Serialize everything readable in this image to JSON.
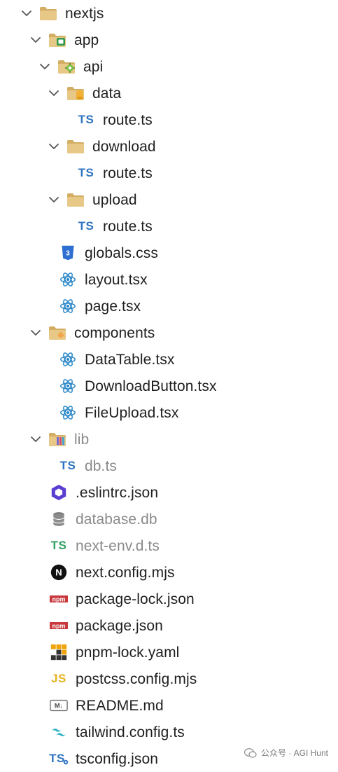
{
  "tree": [
    {
      "label": "nextjs",
      "icon": "folder-open-icon",
      "expanded": true,
      "dim": false
    },
    {
      "label": "app",
      "icon": "folder-app-icon",
      "expanded": true,
      "dim": false
    },
    {
      "label": "api",
      "icon": "folder-api-icon",
      "expanded": true,
      "dim": false
    },
    {
      "label": "data",
      "icon": "folder-data-icon",
      "expanded": true,
      "dim": false
    },
    {
      "label": "route.ts",
      "icon": "typescript-icon",
      "expanded": null,
      "dim": false
    },
    {
      "label": "download",
      "icon": "folder-open-icon",
      "expanded": true,
      "dim": false
    },
    {
      "label": "route.ts",
      "icon": "typescript-icon",
      "expanded": null,
      "dim": false
    },
    {
      "label": "upload",
      "icon": "folder-open-icon",
      "expanded": true,
      "dim": false
    },
    {
      "label": "route.ts",
      "icon": "typescript-icon",
      "expanded": null,
      "dim": false
    },
    {
      "label": "globals.css",
      "icon": "css-icon",
      "expanded": null,
      "dim": false
    },
    {
      "label": "layout.tsx",
      "icon": "react-icon",
      "expanded": null,
      "dim": false
    },
    {
      "label": "page.tsx",
      "icon": "react-icon",
      "expanded": null,
      "dim": false
    },
    {
      "label": "components",
      "icon": "folder-components-icon",
      "expanded": true,
      "dim": false
    },
    {
      "label": "DataTable.tsx",
      "icon": "react-icon",
      "expanded": null,
      "dim": false
    },
    {
      "label": "DownloadButton.tsx",
      "icon": "react-icon",
      "expanded": null,
      "dim": false
    },
    {
      "label": "FileUpload.tsx",
      "icon": "react-icon",
      "expanded": null,
      "dim": false
    },
    {
      "label": "lib",
      "icon": "folder-lib-icon",
      "expanded": true,
      "dim": true
    },
    {
      "label": "db.ts",
      "icon": "typescript-icon",
      "expanded": null,
      "dim": true
    },
    {
      "label": ".eslintrc.json",
      "icon": "eslint-icon",
      "expanded": null,
      "dim": false
    },
    {
      "label": "database.db",
      "icon": "database-icon",
      "expanded": null,
      "dim": true
    },
    {
      "label": "next-env.d.ts",
      "icon": "typescript-green-icon",
      "expanded": null,
      "dim": true
    },
    {
      "label": "next.config.mjs",
      "icon": "nextjs-icon",
      "expanded": null,
      "dim": false
    },
    {
      "label": "package-lock.json",
      "icon": "npm-icon",
      "expanded": null,
      "dim": false
    },
    {
      "label": "package.json",
      "icon": "npm-icon",
      "expanded": null,
      "dim": false
    },
    {
      "label": "pnpm-lock.yaml",
      "icon": "pnpm-icon",
      "expanded": null,
      "dim": false
    },
    {
      "label": "postcss.config.mjs",
      "icon": "javascript-icon",
      "expanded": null,
      "dim": false
    },
    {
      "label": "README.md",
      "icon": "markdown-icon",
      "expanded": null,
      "dim": false
    },
    {
      "label": "tailwind.config.ts",
      "icon": "tailwind-icon",
      "expanded": null,
      "dim": false
    },
    {
      "label": "tsconfig.json",
      "icon": "tsconfig-icon",
      "expanded": null,
      "dim": false
    }
  ],
  "icon_text": {
    "ts": "TS",
    "js": "JS",
    "npm": "npm",
    "next": "N",
    "markdown": "M↓"
  },
  "watermark": {
    "text": "公众号 · AGI Hunt"
  },
  "colors": {
    "folder": "#e8c887",
    "folder_dark": "#d2ad62",
    "app_green": "#2e9a4d",
    "ts_blue": "#2f74c0",
    "ts_green": "#2fa160",
    "react": "#2a87c8",
    "css_blue": "#2f6fd1",
    "eslint": "#5a3fd1",
    "npm_red": "#c8383d",
    "js_yellow": "#e5b421",
    "tailwind": "#2fb2c6"
  }
}
